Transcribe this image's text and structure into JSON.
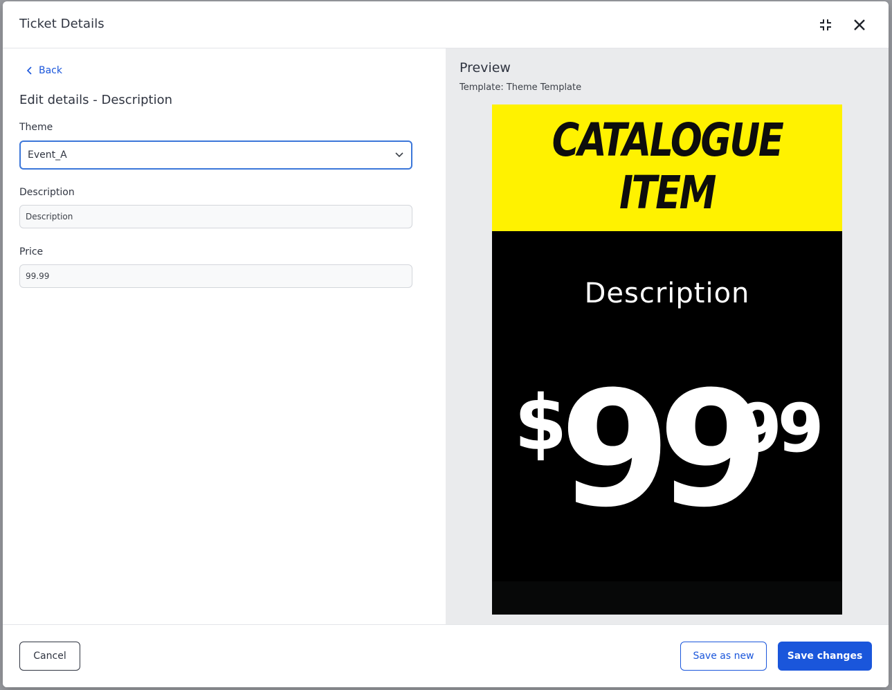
{
  "modal": {
    "title": "Ticket Details"
  },
  "editor": {
    "back_label": "Back",
    "section_title": "Edit details - Description",
    "theme_label": "Theme",
    "theme_value": "Event_A",
    "description_label": "Description",
    "description_value": "Description",
    "price_label": "Price",
    "price_value": "99.99"
  },
  "preview": {
    "title": "Preview",
    "template": "Template: Theme Template",
    "ticket": {
      "heading_line1": "CATALOGUE",
      "heading_line2": "ITEM",
      "description": "Description",
      "currency": "$",
      "price_main": "99",
      "price_cents": "99"
    },
    "colors": {
      "header_bg": "#fff200",
      "body_bg": "#000000"
    }
  },
  "footer": {
    "cancel_label": "Cancel",
    "save_as_new_label": "Save as new",
    "save_changes_label": "Save changes"
  },
  "colors": {
    "accent": "#1a56db"
  }
}
